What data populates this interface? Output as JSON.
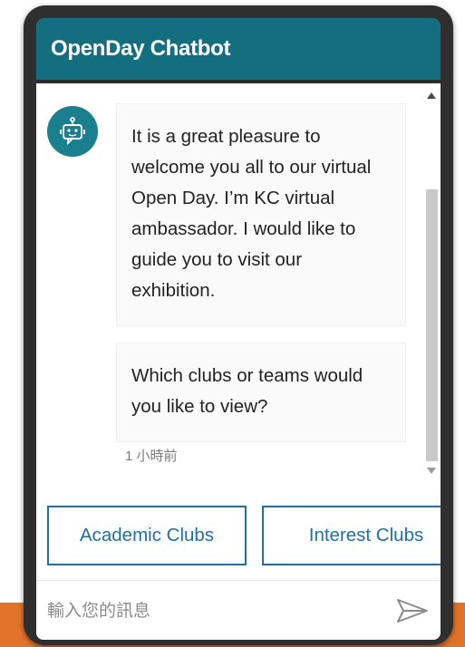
{
  "header": {
    "title": "OpenDay Chatbot"
  },
  "bot": {
    "avatar_icon": "robot-icon"
  },
  "messages": [
    {
      "text": "It is a great pleasure to welcome you all to our virtual Open Day.  I’m KC virtual ambassador.  I would like to guide you to visit our exhibition."
    },
    {
      "text": "Which clubs or teams would you like to view?"
    }
  ],
  "timestamp": "1 小時前",
  "suggested_actions": [
    {
      "label": "Academic Clubs"
    },
    {
      "label": "Interest Clubs"
    }
  ],
  "composer": {
    "placeholder": "輸入您的訊息",
    "send_icon": "send-icon"
  },
  "colors": {
    "header_bg": "#136e80",
    "avatar_bg": "#1a7f8f",
    "button_accent": "#1f6fa6",
    "page_bar": "#e2742a",
    "device_frame": "#2f2f2f"
  }
}
